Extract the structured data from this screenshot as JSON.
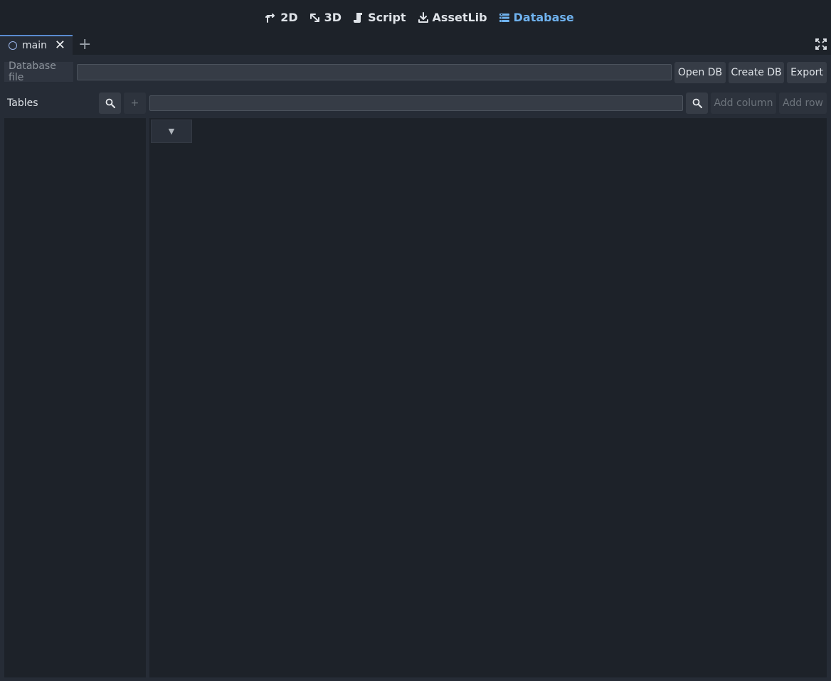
{
  "workspaces": [
    {
      "label": "2D",
      "icon": "2d-icon",
      "active": false
    },
    {
      "label": "3D",
      "icon": "3d-icon",
      "active": false
    },
    {
      "label": "Script",
      "icon": "script-icon",
      "active": false
    },
    {
      "label": "AssetLib",
      "icon": "assetlib-icon",
      "active": false
    },
    {
      "label": "Database",
      "icon": "database-icon",
      "active": true
    }
  ],
  "scene_tab": {
    "label": "main"
  },
  "database": {
    "file_label": "Database file",
    "file_value": "",
    "open_label": "Open DB",
    "create_label": "Create DB",
    "export_label": "Export"
  },
  "tables": {
    "label": "Tables",
    "add_symbol": "+",
    "filter_value": "",
    "add_column_label": "Add column",
    "add_row_label": "Add row",
    "items": []
  },
  "grid": {
    "header_symbol": "▼"
  },
  "colors": {
    "accent": "#6fb2ee",
    "background": "#1d2229",
    "panel": "#262c36",
    "tab_highlight": "#5a8bd0"
  }
}
